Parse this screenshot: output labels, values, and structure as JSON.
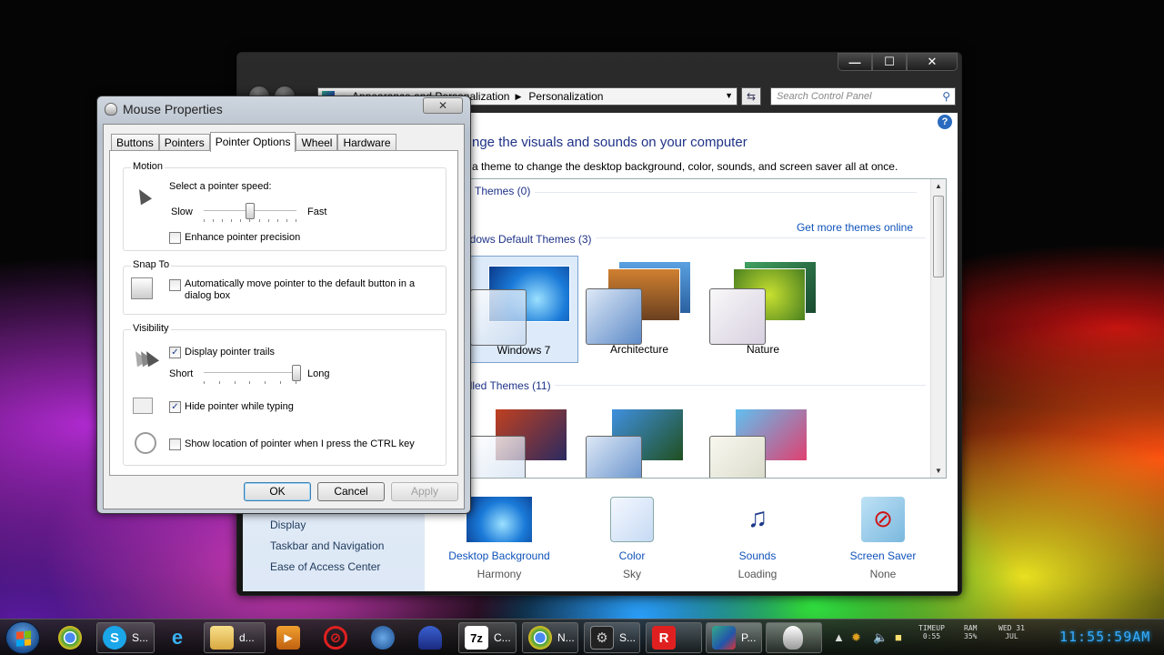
{
  "control_panel": {
    "breadcrumb": [
      "Appearance and Personalization",
      "Personalization"
    ],
    "search_placeholder": "Search Control Panel",
    "heading": "nge the visuals and sounds on your computer",
    "subtext": "a theme to change the desktop background, color, sounds, and screen saver all at once.",
    "get_more_link": "Get more themes online",
    "groups": {
      "my_themes": "Themes (0)",
      "default_themes": "ndows Default Themes (3)",
      "installed_themes": "alled Themes (11)"
    },
    "default_themes": [
      "Windows 7",
      "Architecture",
      "Nature"
    ],
    "left_links": [
      "Display",
      "Taskbar and Navigation",
      "Ease of Access Center"
    ],
    "bottom_items": [
      {
        "label": "Desktop Background",
        "value": "Harmony",
        "icon": "desktop-background-icon"
      },
      {
        "label": "Color",
        "value": "Sky",
        "icon": "color-icon"
      },
      {
        "label": "Sounds",
        "value": "Loading",
        "icon": "sounds-icon"
      },
      {
        "label": "Screen Saver",
        "value": "None",
        "icon": "screen-saver-icon"
      }
    ],
    "caption_buttons": {
      "minimize": "—",
      "maximize": "☐",
      "close": "✕"
    },
    "help": "?"
  },
  "mouse_dialog": {
    "title": "Mouse Properties",
    "close": "✕",
    "tabs": [
      "Buttons",
      "Pointers",
      "Pointer Options",
      "Wheel",
      "Hardware"
    ],
    "active_tab": "Pointer Options",
    "motion": {
      "group": "Motion",
      "speed_label": "Select a pointer speed:",
      "slow": "Slow",
      "fast": "Fast",
      "speed_level": 0.5,
      "enhance_label": "Enhance pointer precision",
      "enhance_checked": false
    },
    "snap_to": {
      "group": "Snap To",
      "label": "Automatically move pointer to the default button in a dialog box",
      "checked": false
    },
    "visibility": {
      "group": "Visibility",
      "trails_label": "Display pointer trails",
      "trails_checked": true,
      "short": "Short",
      "long": "Long",
      "trail_level": 1.0,
      "hide_label": "Hide pointer while typing",
      "hide_checked": true,
      "show_location_label": "Show location of pointer when I press the CTRL key",
      "show_location_checked": false
    },
    "buttons": {
      "ok": "OK",
      "cancel": "Cancel",
      "apply": "Apply"
    },
    "check_glyph": "✓"
  },
  "taskbar": {
    "items": [
      {
        "label": "",
        "icon": "chrome-icon"
      },
      {
        "label": "S...",
        "icon": "skype-icon"
      },
      {
        "label": "",
        "icon": "internet-explorer-icon"
      },
      {
        "label": "d...",
        "icon": "folder-icon"
      },
      {
        "label": "",
        "icon": "media-player-icon"
      },
      {
        "label": "",
        "icon": "no-entry-icon"
      },
      {
        "label": "",
        "icon": "windows-icon"
      },
      {
        "label": "",
        "icon": "wizard-icon"
      },
      {
        "label": "C...",
        "icon": "7zip-icon"
      },
      {
        "label": "N...",
        "icon": "chrome-icon"
      },
      {
        "label": "S...",
        "icon": "steam-icon"
      },
      {
        "label": "",
        "icon": "roblox-icon"
      },
      {
        "label": "P...",
        "icon": "control-panel-icon"
      },
      {
        "label": "",
        "icon": "mouse-icon"
      }
    ],
    "icon_text": {
      "7zip": "7z",
      "roblox": "R"
    },
    "gadgets": {
      "timeup_label": "TIMEUP",
      "timeup_value": "0:55",
      "ram_label": "RAM",
      "ram_value": "35%",
      "date_day": "WED 31",
      "date_month": "JUL"
    },
    "clock": "11:55:59AM"
  },
  "colors": {
    "link": "#0f52ba",
    "heading": "#1e3287",
    "clock": "#39a9ff"
  }
}
